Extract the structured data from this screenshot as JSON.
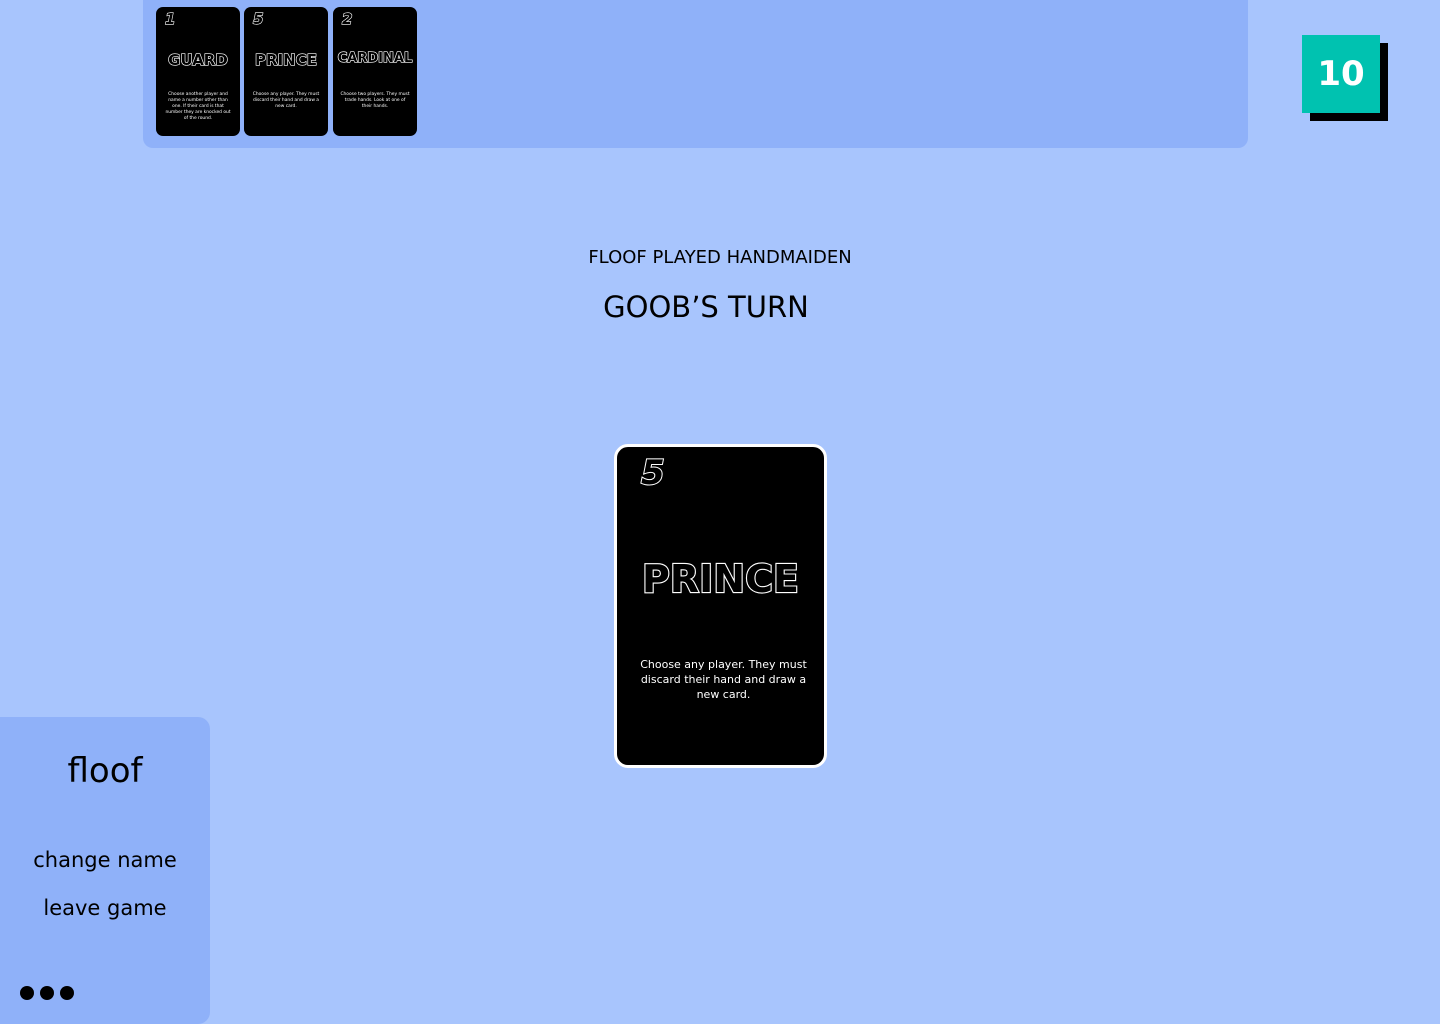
{
  "played_cards": [
    {
      "number": "1",
      "name": "GUARD",
      "description": "Choose another player and name a number other than one. If their card is that number they are knocked out of the round."
    },
    {
      "number": "5",
      "name": "PRINCE",
      "description": "Choose any player. They must discard their hand and draw a new card."
    },
    {
      "number": "2",
      "name": "CARDINAL",
      "description": "Choose two players. They must trade hands. Look at one of their hands."
    }
  ],
  "score": "10",
  "status": {
    "last_action": "FLOOF PLAYED HANDMAIDEN",
    "turn": "GOOB’S TURN"
  },
  "hand_card": {
    "number": "5",
    "name": "PRINCE",
    "description": "Choose any player. They must discard their hand and draw a new card."
  },
  "player_panel": {
    "name": "floof",
    "change_name": "change name",
    "leave_game": "leave game",
    "more_icon": "more-dots-icon"
  },
  "colors": {
    "background": "#a8c5fd",
    "panel": "#8fb1f9",
    "score_badge": "#00c2b0",
    "card": "#000000"
  }
}
